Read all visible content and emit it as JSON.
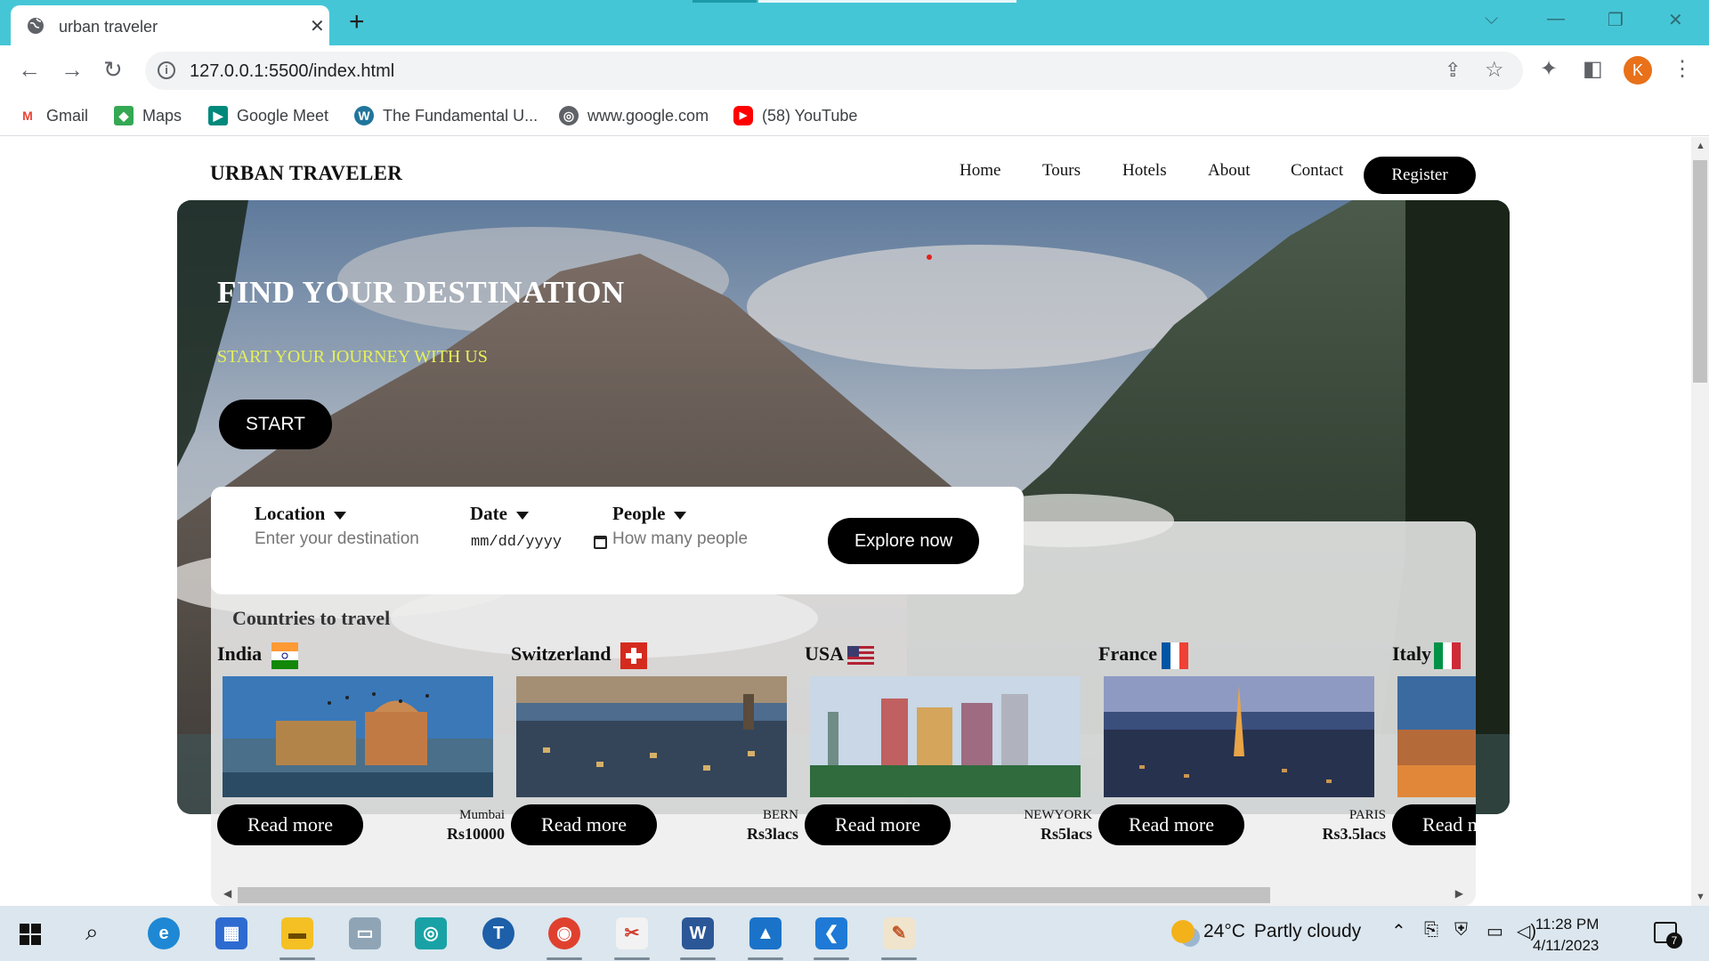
{
  "browser": {
    "tab_title": "urban traveler",
    "tab_close": "✕",
    "new_tab": "+",
    "url": "127.0.0.1:5500/index.html",
    "bookmarks": [
      {
        "label": "Gmail",
        "icon": "gmail-icon",
        "glyph": "M",
        "color": "#ea4335"
      },
      {
        "label": "Maps",
        "icon": "maps-icon",
        "glyph": "◆",
        "color": "#34a853"
      },
      {
        "label": "Google Meet",
        "icon": "meet-icon",
        "glyph": "▶",
        "color": "#00897b"
      },
      {
        "label": "The Fundamental U...",
        "icon": "wordpress-icon",
        "glyph": "W",
        "color": "#21759b"
      },
      {
        "label": "www.google.com",
        "icon": "globe-icon",
        "glyph": "◎",
        "color": "#5f6368"
      },
      {
        "label": "(58) YouTube",
        "icon": "youtube-icon",
        "glyph": "▶",
        "color": "#ff0000"
      }
    ],
    "profile_initial": "K"
  },
  "site": {
    "logo": "URBAN TRAVELER",
    "nav": [
      "Home",
      "Tours",
      "Hotels",
      "About",
      "Contact"
    ],
    "register": "Register"
  },
  "hero": {
    "title": "FIND YOUR DESTINATION",
    "subtitle": "START YOUR JOURNEY WITH US",
    "start_button": "START"
  },
  "search": {
    "location_label": "Location",
    "location_placeholder": "Enter your destination",
    "date_label": "Date",
    "date_value": "mm/dd/yyyy",
    "people_label": "People",
    "people_placeholder": "How many people",
    "explore_button": "Explore now"
  },
  "countries": {
    "heading": "Countries to travel",
    "items": [
      {
        "name": "India",
        "city": "Mumbai",
        "price": "Rs10000",
        "read_more": "Read more"
      },
      {
        "name": "Switzerland",
        "city": "BERN",
        "price": "Rs3lacs",
        "read_more": "Read more"
      },
      {
        "name": "USA",
        "city": "NEWYORK",
        "price": "Rs5lacs",
        "read_more": "Read more"
      },
      {
        "name": "France",
        "city": "PARIS",
        "price": "Rs3.5lacs",
        "read_more": "Read more"
      },
      {
        "name": "Italy",
        "city": "",
        "price": "",
        "read_more": "Read more"
      }
    ]
  },
  "taskbar": {
    "weather_temp": "24°C",
    "weather_text": "Partly cloudy",
    "time": "11:28 PM",
    "date": "4/11/2023",
    "notification_count": "7"
  }
}
